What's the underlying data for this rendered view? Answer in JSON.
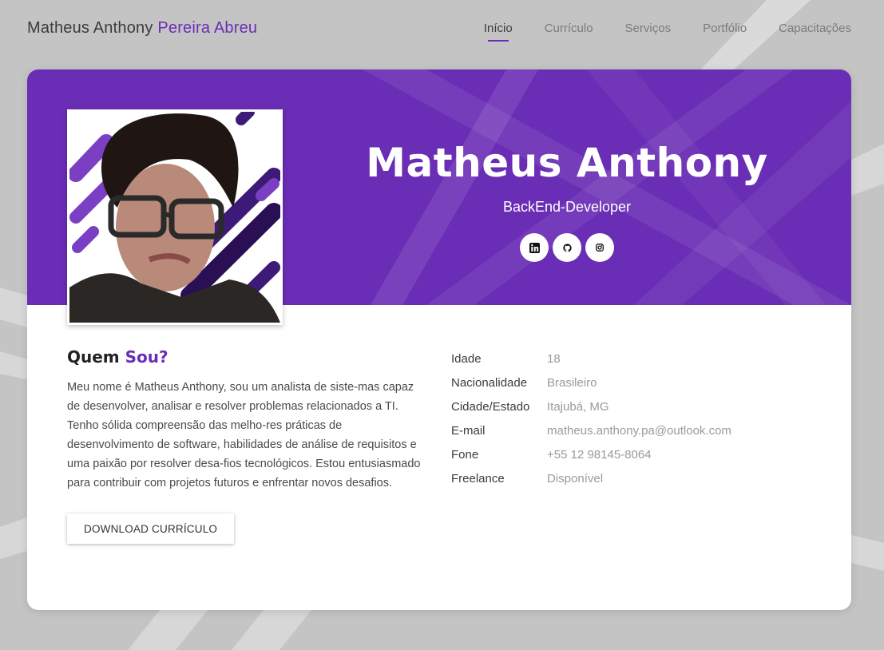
{
  "header": {
    "brand_first": "Matheus Anthony",
    "brand_accent": "Pereira Abreu",
    "nav": [
      {
        "label": "Início",
        "active": true
      },
      {
        "label": "Currículo"
      },
      {
        "label": "Serviços"
      },
      {
        "label": "Portfólio"
      },
      {
        "label": "Capacitações"
      }
    ]
  },
  "hero": {
    "name": "Matheus Anthony",
    "role": "BackEnd-Developer",
    "socials": [
      {
        "icon": "linkedin-icon"
      },
      {
        "icon": "github-icon"
      },
      {
        "icon": "instagram-icon"
      }
    ]
  },
  "about": {
    "title_first": "Quem",
    "title_accent": "Sou?",
    "text": "Meu nome é Matheus Anthony, sou um analista de siste-mas capaz de desenvolver, analisar e resolver problemas relacionados a TI. Tenho sólida compreensão das melho-res práticas de desenvolvimento de software, habilidades de análise de requisitos e uma paixão por resolver desa-fios tecnológicos. Estou entusiasmado para contribuir com projetos futuros e enfrentar novos desafios.",
    "download_label": "DOWNLOAD CURRÍCULO"
  },
  "info": [
    {
      "label": "Idade",
      "value": "18"
    },
    {
      "label": "Nacionalidade",
      "value": "Brasileiro"
    },
    {
      "label": "Cidade/Estado",
      "value": "Itajubá, MG"
    },
    {
      "label": "E-mail",
      "value": "matheus.anthony.pa@outlook.com"
    },
    {
      "label": "Fone",
      "value": "+55 12 98145-8064"
    },
    {
      "label": "Freelance",
      "value": "Disponível"
    }
  ],
  "colors": {
    "accent": "#6a2db5",
    "page_bg": "#c4c4c4"
  }
}
